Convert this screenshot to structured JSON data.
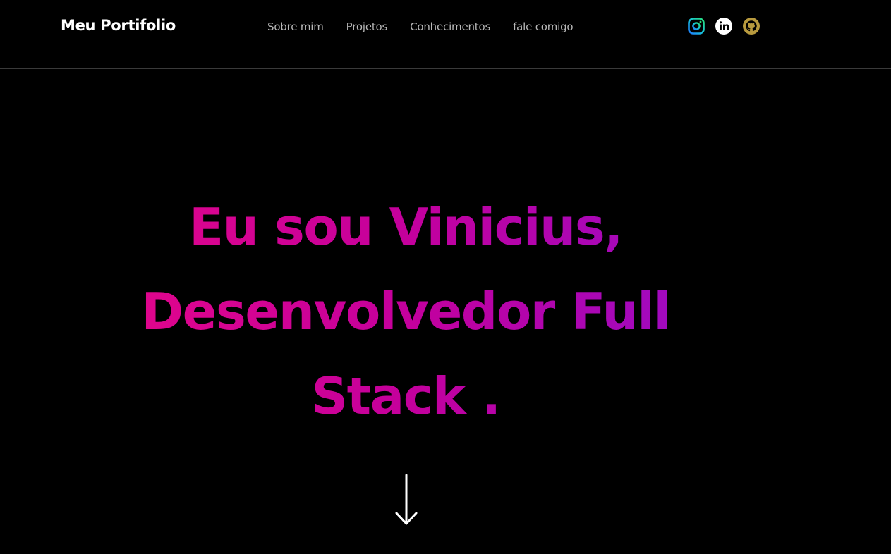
{
  "header": {
    "brand": "Meu Portifolio",
    "nav": [
      {
        "label": "Sobre mim"
      },
      {
        "label": "Projetos"
      },
      {
        "label": "Conhecimentos"
      },
      {
        "label": "fale comigo"
      }
    ],
    "socials": [
      {
        "icon": "instagram-icon"
      },
      {
        "icon": "linkedin-icon"
      },
      {
        "icon": "github-icon",
        "color": "#b89a3e"
      }
    ]
  },
  "hero": {
    "title": "Eu sou Vinicius, Desenvolvedor Full Stack .",
    "gradient": [
      "#e3068a",
      "#c4009c",
      "#9b0bc4"
    ]
  },
  "scroll_icon": "arrow-down-icon"
}
